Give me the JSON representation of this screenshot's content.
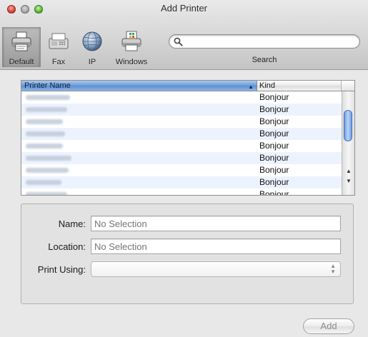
{
  "window": {
    "title": "Add Printer",
    "traffic_lights": [
      "close",
      "minimize",
      "zoom"
    ]
  },
  "toolbar": {
    "items": [
      {
        "label": "Default",
        "icon": "printer-icon",
        "selected": true
      },
      {
        "label": "Fax",
        "icon": "fax-icon",
        "selected": false
      },
      {
        "label": "IP",
        "icon": "globe-icon",
        "selected": false
      },
      {
        "label": "Windows",
        "icon": "windows-printer-icon",
        "selected": false
      }
    ],
    "search": {
      "placeholder": "",
      "value": "",
      "label": "Search",
      "icon": "magnifier-icon"
    }
  },
  "printer_table": {
    "columns": [
      {
        "label": "Printer Name",
        "sorted": true,
        "sort_direction": "ascending"
      },
      {
        "label": "Kind",
        "sorted": false
      }
    ],
    "rows": [
      {
        "kind": "Bonjour"
      },
      {
        "kind": "Bonjour"
      },
      {
        "kind": "Bonjour"
      },
      {
        "kind": "Bonjour"
      },
      {
        "kind": "Bonjour"
      },
      {
        "kind": "Bonjour"
      },
      {
        "kind": "Bonjour"
      },
      {
        "kind": "Bonjour"
      },
      {
        "kind": "Bonjour"
      }
    ],
    "scroll_position": 0.2
  },
  "details": {
    "name_label": "Name:",
    "name_placeholder": "No Selection",
    "location_label": "Location:",
    "location_placeholder": "No Selection",
    "print_using_label": "Print Using:",
    "print_using_value": ""
  },
  "actions": {
    "add_label": "Add"
  },
  "colors": {
    "header_selected": "#6e9cd8",
    "row_alternate": "#edf3fe",
    "scroll_thumb": "#6e9de0"
  }
}
